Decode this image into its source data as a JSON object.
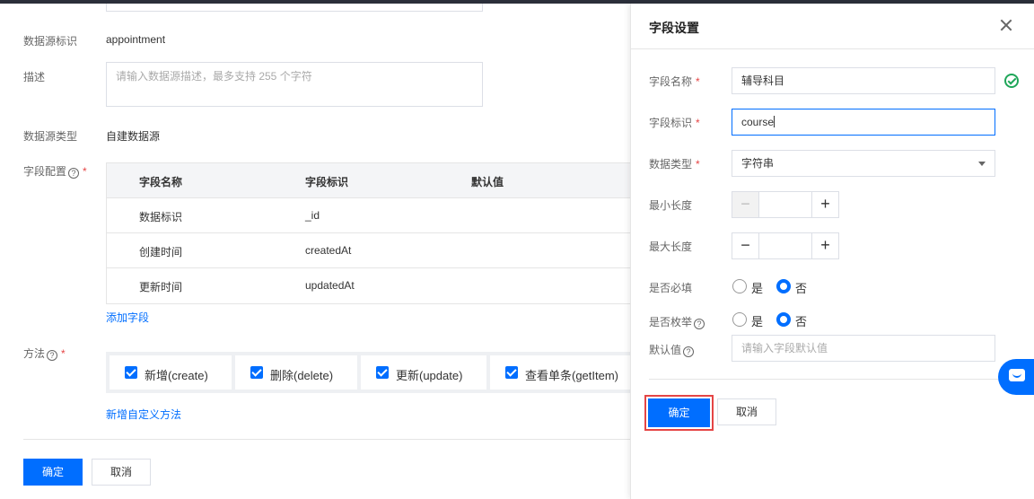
{
  "form": {
    "source_id_label": "数据源标识",
    "source_id_value": "appointment",
    "desc_label": "描述",
    "desc_placeholder": "请输入数据源描述，最多支持 255 个字符",
    "source_type_label": "数据源类型",
    "source_type_value": "自建数据源",
    "fields_label": "字段配置",
    "table": {
      "headers": [
        "字段名称",
        "字段标识",
        "默认值"
      ],
      "rows": [
        [
          "数据标识",
          "_id",
          ""
        ],
        [
          "创建时间",
          "createdAt",
          ""
        ],
        [
          "更新时间",
          "updatedAt",
          ""
        ]
      ]
    },
    "add_field_link": "添加字段",
    "methods_label": "方法",
    "methods": [
      "新增(create)",
      "删除(delete)",
      "更新(update)",
      "查看单条(getItem)"
    ],
    "add_method_link": "新增自定义方法",
    "confirm": "确定",
    "cancel": "取消"
  },
  "drawer": {
    "title": "字段设置",
    "name_label": "字段名称",
    "name_value": "辅导科目",
    "id_label": "字段标识",
    "id_value": "course",
    "type_label": "数据类型",
    "type_value": "字符串",
    "min_label": "最小长度",
    "max_label": "最大长度",
    "required_label": "是否必填",
    "enum_label": "是否枚举",
    "yes": "是",
    "no": "否",
    "default_label": "默认值",
    "default_placeholder": "请输入字段默认值",
    "confirm": "确定",
    "cancel": "取消"
  },
  "colors": {
    "primary": "#006eff",
    "required": "#e54545",
    "success": "#1fa659",
    "highlight": "#e54545"
  }
}
